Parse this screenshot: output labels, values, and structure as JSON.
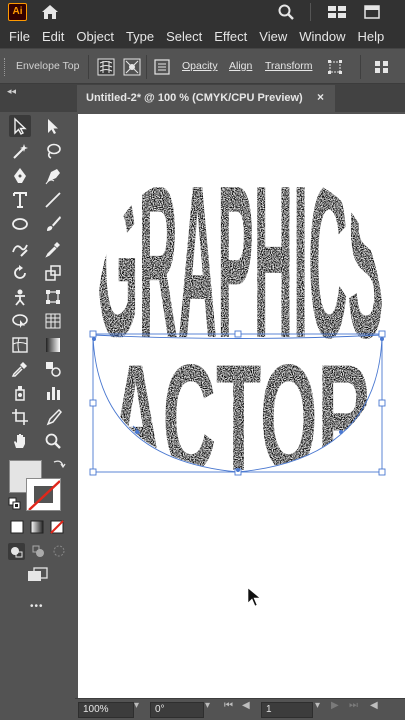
{
  "app": {
    "logo_text": "Ai",
    "brand_color": "#ff9a00"
  },
  "menu": {
    "items": [
      "File",
      "Edit",
      "Object",
      "Type",
      "Select",
      "Effect",
      "View",
      "Window",
      "Help"
    ]
  },
  "control_bar": {
    "envelope_label": "Envelope Top",
    "opacity_label": "Opacity",
    "align_label": "Align",
    "transform_label": "Transform"
  },
  "document": {
    "tab_title": "Untitled-2* @ 100 % (CMYK/CPU Preview)",
    "close_glyph": "×"
  },
  "artwork": {
    "line1": "GRAPHICS",
    "line2": "ACTOR",
    "selection_color": "#4a78d0"
  },
  "toolbar": {
    "fill_color": "#e4e4e4",
    "stroke_color": "#ffffff",
    "more_glyph": "•••"
  },
  "status_bar": {
    "zoom": "100%",
    "rotation": "0°",
    "artboard_number": "1"
  }
}
